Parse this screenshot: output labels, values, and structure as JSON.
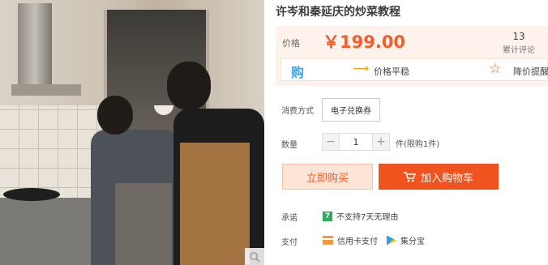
{
  "product": {
    "title": "许岑和秦延庆的炒菜教程"
  },
  "price_box": {
    "label": "价格",
    "price": "￥199.00",
    "review_count": "13",
    "review_label": "累计评论",
    "trend_icon": "购",
    "trend_text": "价格平稳",
    "alert_text": "降价提醒",
    "accent_color": "#f35d2a"
  },
  "purchase_method": {
    "label": "消费方式",
    "option": "电子兑换券"
  },
  "quantity": {
    "label": "数量",
    "value": "1",
    "minus": "−",
    "plus": "+",
    "limit_text": "件(限购1件)"
  },
  "actions": {
    "buy_now": "立即购买",
    "add_to_cart": "加入购物车"
  },
  "promise": {
    "label": "承诺",
    "badge": "7",
    "text": "不支持7天无理由"
  },
  "payment": {
    "label": "支付",
    "methods": [
      {
        "icon": "credit-card-icon",
        "text": "信用卡支付"
      },
      {
        "icon": "jifenbao-icon",
        "text": "集分宝"
      }
    ]
  }
}
